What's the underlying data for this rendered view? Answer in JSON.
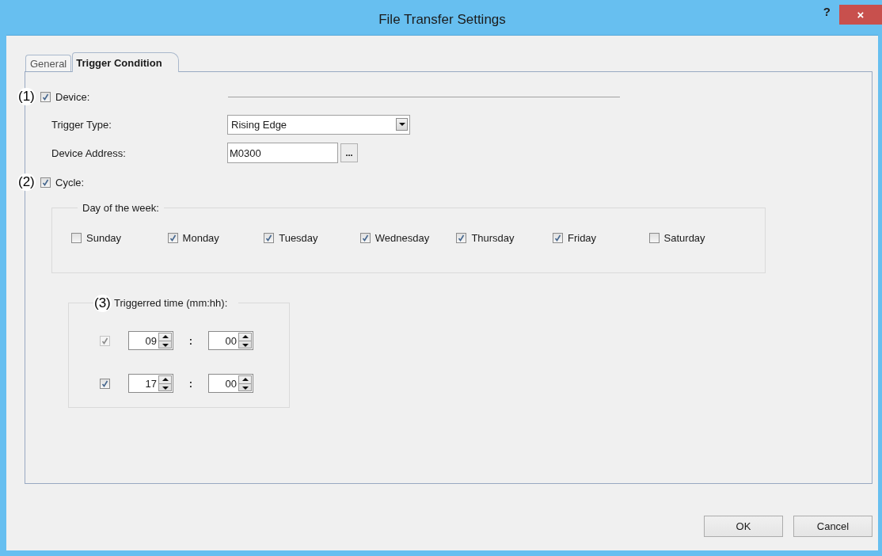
{
  "window": {
    "title": "File Transfer Settings",
    "help": "?",
    "close": "×"
  },
  "tabs": [
    {
      "label": "General",
      "selected": false
    },
    {
      "label": "Trigger Condition",
      "selected": true
    }
  ],
  "device": {
    "marker": "(1)",
    "label": "Device:",
    "checked": true,
    "fields": [
      {
        "kind": "dropdown",
        "label": "Trigger Type:",
        "value": "Rising Edge"
      },
      {
        "kind": "browse",
        "label": "Device Address:",
        "value": "M0300",
        "button": "..."
      }
    ]
  },
  "cycle": {
    "marker": "(2)",
    "label": "Cycle:",
    "checked": true,
    "days_group": {
      "title": "Day of the week:",
      "days": [
        {
          "label": "Sunday",
          "checked": false
        },
        {
          "label": "Monday",
          "checked": true
        },
        {
          "label": "Tuesday",
          "checked": true
        },
        {
          "label": "Wednesday",
          "checked": true
        },
        {
          "label": "Thursday",
          "checked": true
        },
        {
          "label": "Friday",
          "checked": true
        },
        {
          "label": "Saturday",
          "checked": false
        }
      ]
    },
    "time_group": {
      "marker": "(3)",
      "title": "Triggerred time (mm:hh):",
      "times": [
        {
          "checked": true,
          "disabled": true,
          "hour": "09",
          "separator": ":",
          "minute": "00"
        },
        {
          "checked": true,
          "disabled": false,
          "hour": "17",
          "separator": ":",
          "minute": "00"
        }
      ]
    }
  },
  "buttons": [
    "OK",
    "Cancel"
  ]
}
